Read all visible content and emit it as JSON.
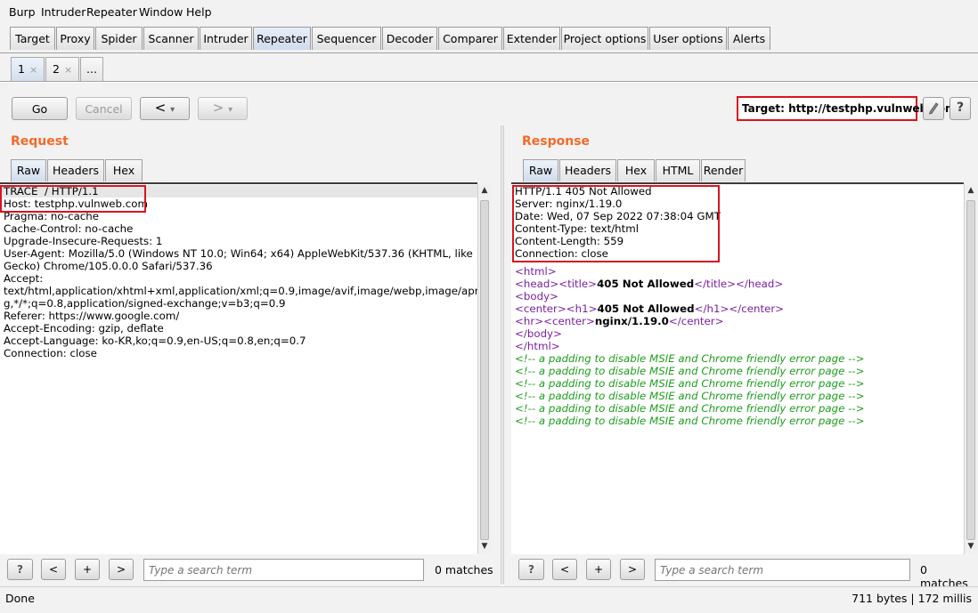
{
  "menu": [
    "Burp",
    "Intruder",
    "Repeater",
    "Window",
    "Help"
  ],
  "main_tabs": [
    "Target",
    "Proxy",
    "Spider",
    "Scanner",
    "Intruder",
    "Repeater",
    "Sequencer",
    "Decoder",
    "Comparer",
    "Extender",
    "Project options",
    "User options",
    "Alerts"
  ],
  "active_main_tab": "Repeater",
  "sub_tabs": [
    {
      "label": "1",
      "close": "×"
    },
    {
      "label": "2",
      "close": "×"
    },
    {
      "label": "..."
    }
  ],
  "toolbar": {
    "go_label": "Go",
    "cancel_label": "Cancel",
    "back_label": "<",
    "forward_label": ">",
    "dropdown_glyph": "▾",
    "target_label": "Target: http://testphp.vulnweb.com",
    "edit_icon": "pencil-icon",
    "help_label": "?"
  },
  "request": {
    "title": "Request",
    "tabs": [
      "Raw",
      "Headers",
      "Hex"
    ],
    "lines": [
      "TRACE  / HTTP/1.1",
      "Host: testphp.vulnweb.com",
      "Pragma: no-cache",
      "Cache-Control: no-cache",
      "Upgrade-Insecure-Requests: 1",
      "User-Agent: Mozilla/5.0 (Windows NT 10.0; Win64; x64) AppleWebKit/537.36 (KHTML, like",
      "Gecko) Chrome/105.0.0.0 Safari/537.36",
      "Accept:",
      "text/html,application/xhtml+xml,application/xml;q=0.9,image/avif,image/webp,image/apn",
      "g,*/*;q=0.8,application/signed-exchange;v=b3;q=0.9",
      "Referer: https://www.google.com/",
      "Accept-Encoding: gzip, deflate",
      "Accept-Language: ko-KR,ko;q=0.9,en-US;q=0.8,en;q=0.7",
      "Connection: close"
    ],
    "search": {
      "help": "?",
      "prev": "<",
      "add": "+",
      "next": ">",
      "placeholder": "Type a search term",
      "matches": "0 matches"
    }
  },
  "response": {
    "title": "Response",
    "tabs": [
      "Raw",
      "Headers",
      "Hex",
      "HTML",
      "Render"
    ],
    "header_lines": [
      "HTTP/1.1 405 Not Allowed",
      "Server: nginx/1.19.0",
      "Date: Wed, 07 Sep 2022 07:38:04 GMT",
      "Content-Type: text/html",
      "Content-Length: 559",
      "Connection: close"
    ],
    "body": {
      "html_open": "<html>",
      "head_open": "<head>",
      "title_open": "<title>",
      "title_text": "405 Not Allowed",
      "title_close": "</title>",
      "head_close": "</head>",
      "body_open": "<body>",
      "center_open": "<center>",
      "h1_open": "<h1>",
      "h1_text": "405 Not Allowed",
      "h1_close": "</h1>",
      "center_close": "</center>",
      "hr": "<hr>",
      "server_text": "nginx/1.19.0",
      "body_close": "</body>",
      "html_close": "</html>",
      "comment": "<!-- a padding to disable MSIE and Chrome friendly error page -->"
    },
    "comment_lines": 6,
    "search": {
      "help": "?",
      "prev": "<",
      "add": "+",
      "next": ">",
      "placeholder": "Type a search term",
      "matches": "0 matches"
    }
  },
  "status": {
    "left": "Done",
    "right": "711 bytes | 172 millis"
  },
  "colors": {
    "section_title": "#f26a2a",
    "highlight_box": "#d8141e",
    "tag": "#7b1fa2",
    "comment": "#1e9e1e"
  }
}
